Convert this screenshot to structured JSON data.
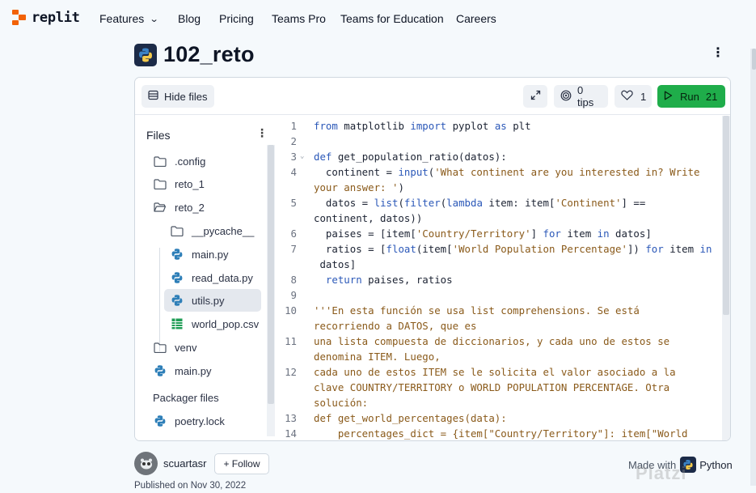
{
  "brand": {
    "name": "replit",
    "accent": "#f26207"
  },
  "nav": [
    {
      "label": "Features",
      "has_dropdown": true
    },
    {
      "label": "Blog"
    },
    {
      "label": "Pricing"
    },
    {
      "label": "Teams Pro"
    },
    {
      "label": "Teams for Education"
    },
    {
      "label": "Careers"
    }
  ],
  "repl": {
    "title": "102_reto",
    "icon": "python-icon"
  },
  "toolbar": {
    "hide_files": "Hide files",
    "tips": "0 tips",
    "likes": "1",
    "run": "Run",
    "run_count": "21",
    "run_color": "#1fad4a"
  },
  "files": {
    "header": "Files",
    "tree": [
      {
        "name": ".config",
        "type": "folder"
      },
      {
        "name": "reto_1",
        "type": "folder"
      },
      {
        "name": "reto_2",
        "type": "folder-open"
      },
      {
        "name": "__pycache__",
        "type": "folder"
      },
      {
        "name": "main.py",
        "type": "python"
      },
      {
        "name": "read_data.py",
        "type": "python"
      },
      {
        "name": "utils.py",
        "type": "python",
        "active": true
      },
      {
        "name": "world_pop.csv",
        "type": "csv"
      },
      {
        "name": "venv",
        "type": "folder"
      },
      {
        "name": "main.py",
        "type": "python"
      }
    ],
    "packager_header": "Packager files",
    "packager": [
      {
        "name": "poetry.lock",
        "type": "python"
      }
    ]
  },
  "editor": {
    "line_numbers": [
      "1",
      "2",
      "3",
      "4",
      "5",
      "6",
      "7",
      "8",
      "9",
      "10",
      "11",
      "12",
      "13",
      "14"
    ],
    "lines": [
      "from matplotlib import pyplot as plt",
      "",
      "def get_population_ratio(datos):",
      "  continent = input('What continent are you interested in? Write",
      "your answer: ')",
      "  datos = list(filter(lambda item: item['Continent'] ==",
      "continent, datos))",
      "  paises = [item['Country/Territory'] for item in datos]",
      "  ratios = [float(item['World Population Percentage']) for item in",
      " datos]",
      "  return paises, ratios",
      "",
      "'''En esta función se usa list comprehensions. Se está",
      "recorriendo a DATOS, que es",
      "una lista compuesta de diccionarios, y cada uno de estos se",
      "denomina ITEM. Luego,",
      "cada uno de estos ITEM se le solicita el valor asociado a la",
      "clave COUNTRY/TERRITORY o WORLD POPULATION PERCENTAGE. Otra",
      "solución:",
      "def get_world_percentages(data):",
      "    percentages_dict = {item[\"Country/Territory\"]: item[\"World"
    ]
  },
  "author": {
    "name": "scuartasr",
    "follow": "+ Follow",
    "published": "Published on Nov 30, 2022"
  },
  "made_with": {
    "prefix": "Made with",
    "lang": "Python"
  },
  "watermark": "Platzi"
}
